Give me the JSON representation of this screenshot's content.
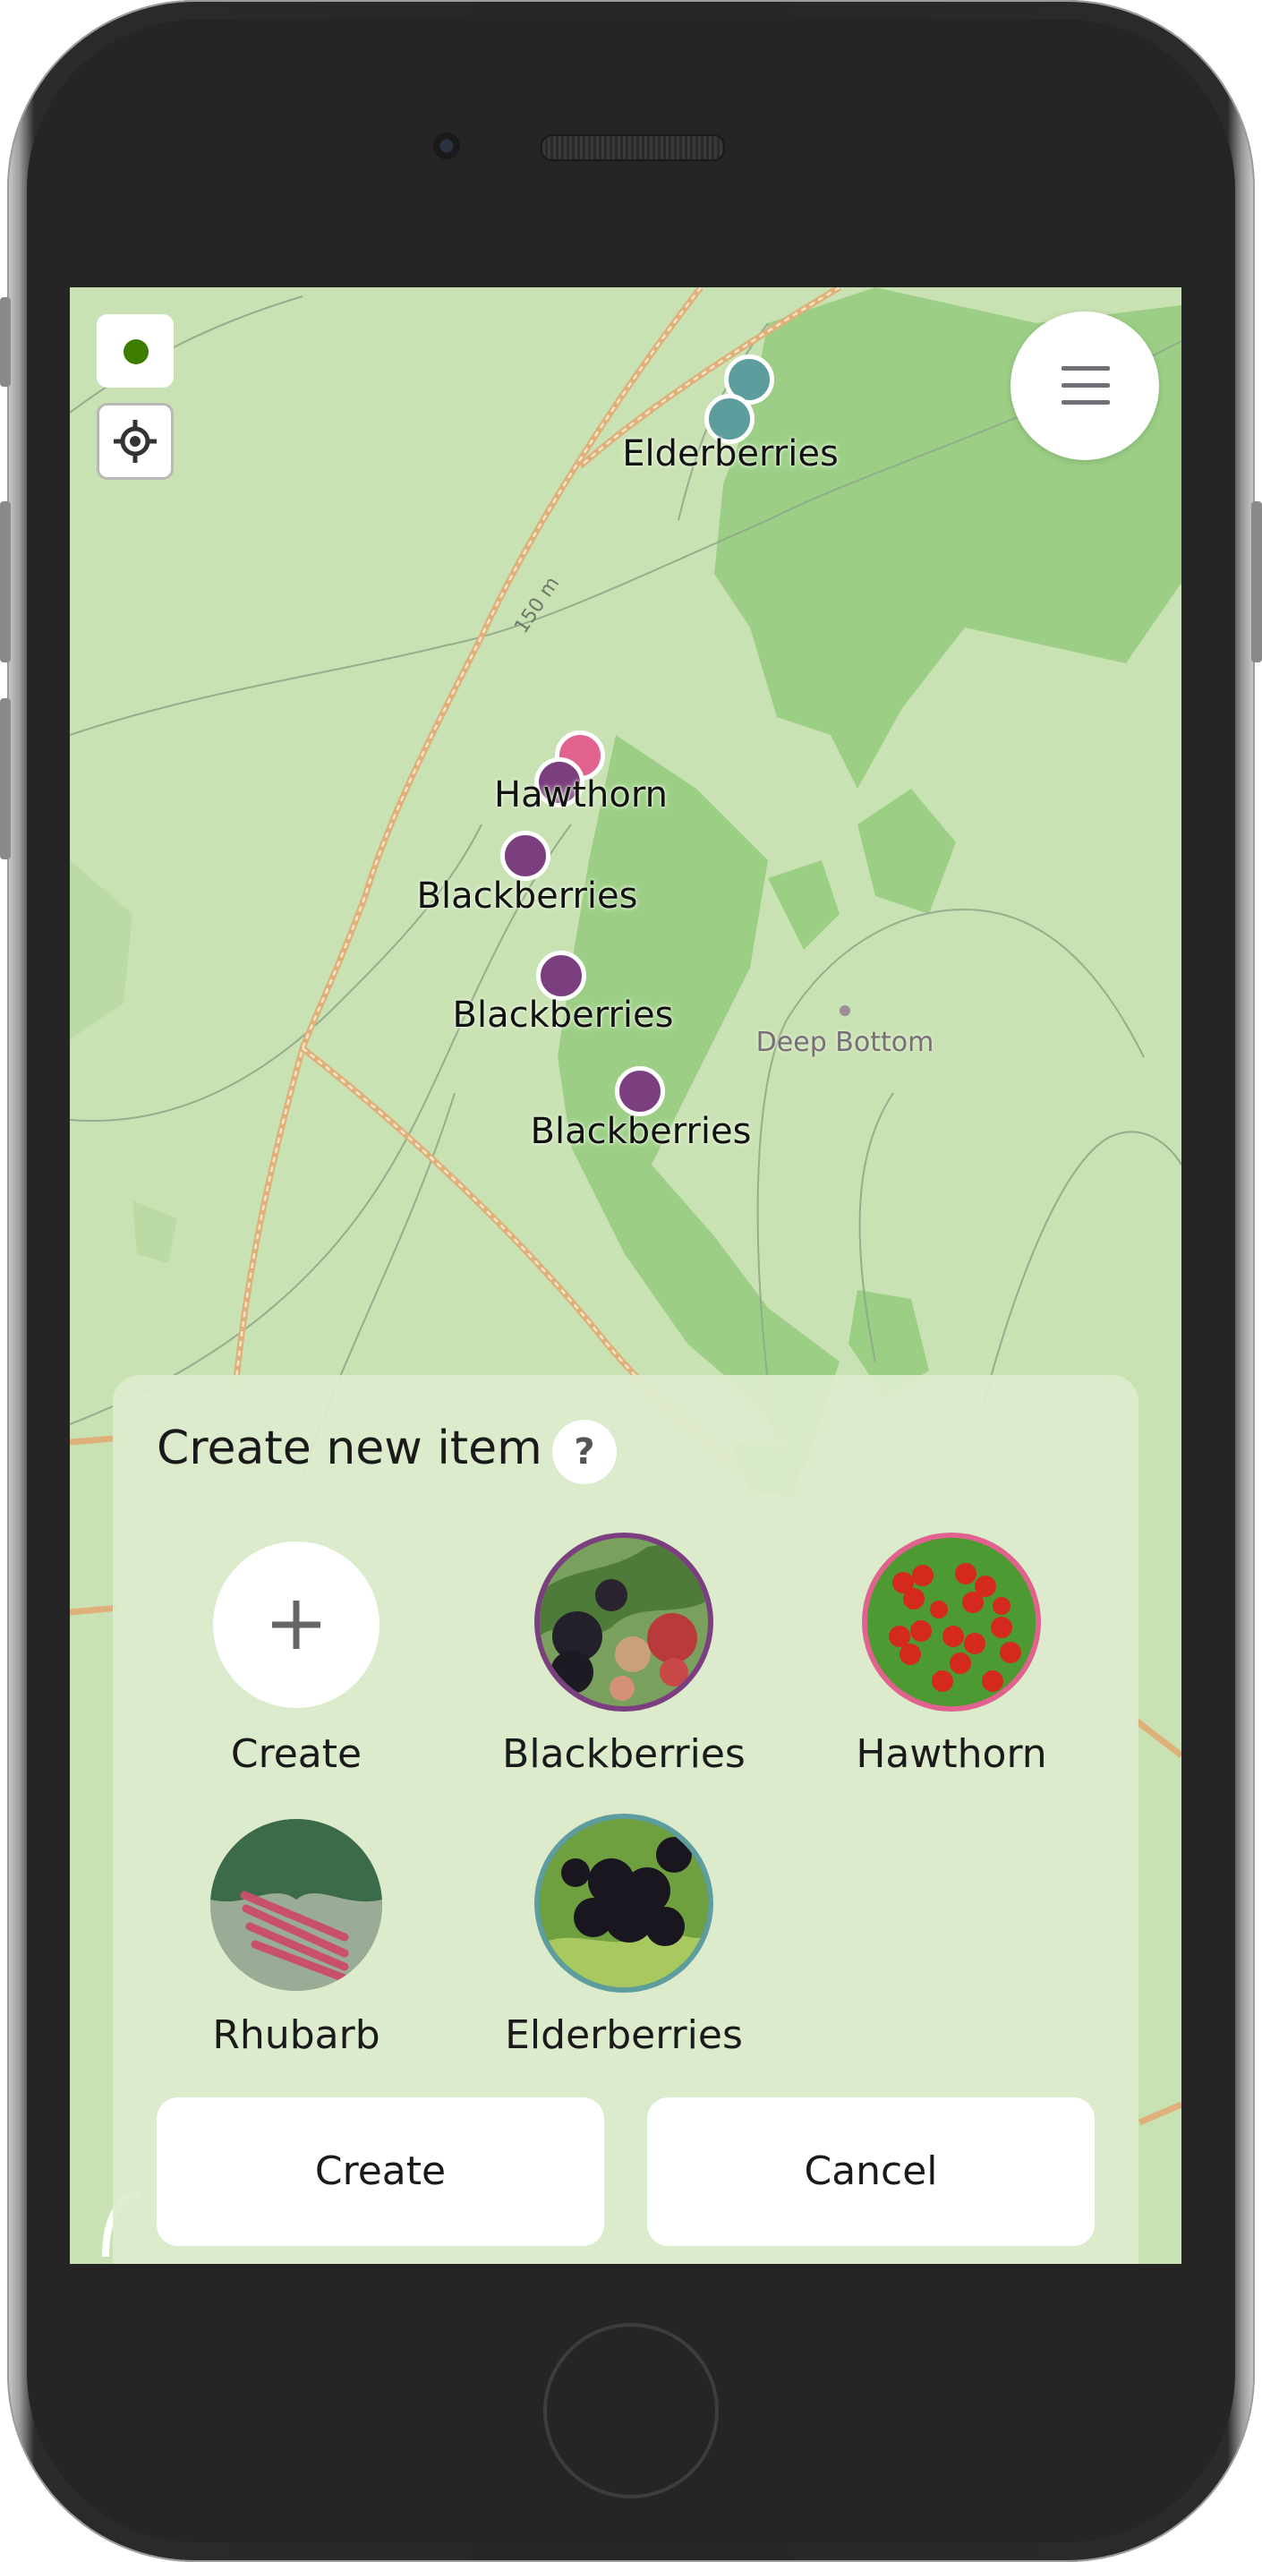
{
  "map": {
    "markers": [
      {
        "label": "Elderberries",
        "color": "#5e9d9e"
      },
      {
        "label": "Hawthorn",
        "color": "#e2628f"
      },
      {
        "label": "Blackberries",
        "color": "#7b3f80"
      },
      {
        "label": "Blackberries",
        "color": "#7b3f80"
      },
      {
        "label": "Blackberries",
        "color": "#7b3f80"
      }
    ],
    "contour_label": "150 m",
    "place_label": "Deep Bottom"
  },
  "controls": {
    "gps_icon": "gps-status-dot",
    "gps_color": "#3d7e00",
    "locate_icon": "crosshair-icon",
    "menu_icon": "hamburger-icon"
  },
  "panel": {
    "title": "Create new item",
    "help": "?",
    "items": [
      {
        "label": "Create",
        "icon": "plus-icon"
      },
      {
        "label": "Blackberries",
        "ring_color": "#7b3f80"
      },
      {
        "label": "Hawthorn",
        "ring_color": "#e2628f"
      },
      {
        "label": "Rhubarb"
      },
      {
        "label": "Elderberries",
        "ring_color": "#5e9d9e"
      }
    ],
    "create_button": "Create",
    "cancel_button": "Cancel"
  }
}
